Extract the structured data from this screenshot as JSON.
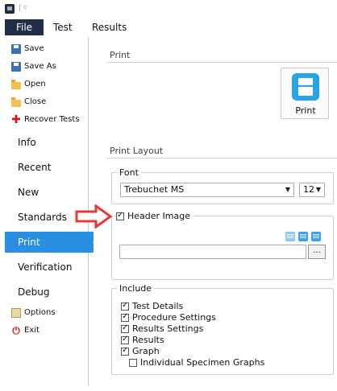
{
  "menu": {
    "file": "File",
    "test": "Test",
    "results": "Results"
  },
  "sidebar": {
    "file_actions": [
      {
        "label": "Save",
        "icon": "save-icon"
      },
      {
        "label": "Save As",
        "icon": "save-as-icon"
      },
      {
        "label": "Open",
        "icon": "open-folder-icon"
      },
      {
        "label": "Close",
        "icon": "close-folder-icon"
      },
      {
        "label": "Recover Tests",
        "icon": "plus-icon"
      }
    ],
    "sections": [
      "Info",
      "Recent",
      "New",
      "Standards",
      "Print",
      "Verification",
      "Debug"
    ],
    "active_section": "Print",
    "footer_actions": [
      {
        "label": "Options",
        "icon": "options-icon"
      },
      {
        "label": "Exit",
        "icon": "power-icon"
      }
    ]
  },
  "main": {
    "print_heading": "Print",
    "print_button_label": "Print",
    "layout_heading": "Print Layout",
    "font_group": {
      "legend": "Font",
      "font_value": "Trebuchet MS",
      "size_value": "12"
    },
    "header_image": {
      "label": "Header Image",
      "checked": true,
      "path_value": "",
      "browse_label": "..."
    },
    "include_group": {
      "legend": "Include",
      "items": [
        {
          "label": "Test Details",
          "checked": true
        },
        {
          "label": "Procedure Settings",
          "checked": true
        },
        {
          "label": "Results Settings",
          "checked": true
        },
        {
          "label": "Results",
          "checked": true
        },
        {
          "label": "Graph",
          "checked": true
        },
        {
          "label": "Individual Specimen Graphs",
          "checked": false
        }
      ]
    }
  },
  "colors": {
    "accent": "#2a8fe0",
    "file_tab": "#1f2d45",
    "annotation_arrow": "#e53935"
  }
}
